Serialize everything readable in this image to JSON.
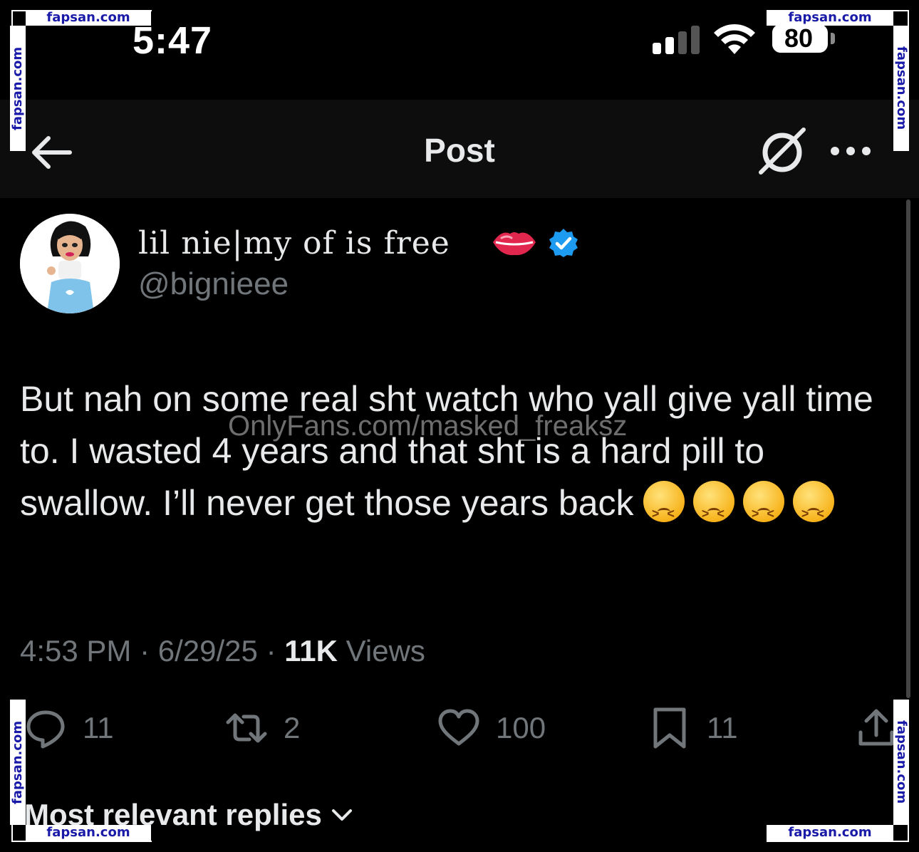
{
  "status_bar": {
    "time": "5:47",
    "battery_level": "80",
    "signal_bars_active": 2,
    "signal_bars_total": 4,
    "icons": [
      "cellular-signal-icon",
      "wifi-icon",
      "battery-icon"
    ]
  },
  "header": {
    "title": "Post",
    "back_icon": "arrow-left-icon",
    "grok_icon": "grok-icon",
    "more_icon": "more-horizontal-icon"
  },
  "author": {
    "display_name": "lil nie|my of is free",
    "name_emoji": "lips-icon",
    "verified_icon": "verified-badge-icon",
    "handle": "@bignieee"
  },
  "tweet": {
    "text": "But nah on some real sht watch who yall give yall time to. I wasted 4 years and that sht is a hard pill to swallow. I’ll never get those years back",
    "emoji_name": "persevering-face-emoji",
    "emoji_count": 4,
    "overlay_text": "OnlyFans.com/masked_freaksz"
  },
  "meta": {
    "time": "4:53 PM",
    "separator": "·",
    "date": "6/29/25",
    "views_count": "11K",
    "views_label": "Views"
  },
  "actions": {
    "replies": "11",
    "reposts": "2",
    "likes": "100",
    "bookmarks": "11"
  },
  "replies_section": {
    "label": "Most relevant replies"
  },
  "watermark": {
    "site": "fapsan.com"
  },
  "colors": {
    "background": "#000000",
    "text_primary": "#e7e9ea",
    "text_secondary": "#71767b",
    "verified_blue": "#1d9bf0",
    "watermark_blue": "#1a1aa8"
  }
}
